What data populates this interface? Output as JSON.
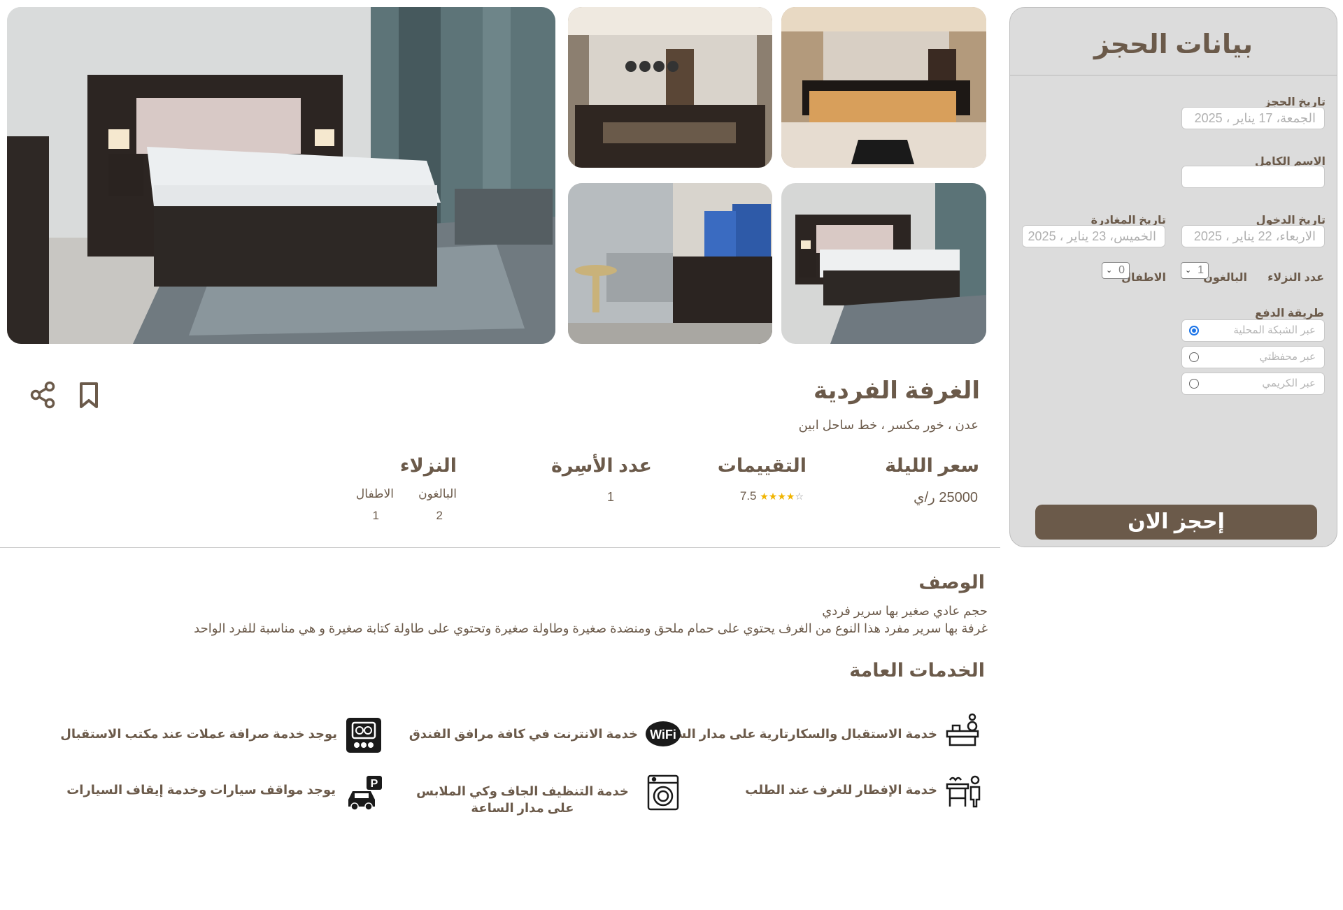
{
  "booking_panel": {
    "title": "بيانات الحجز",
    "booking_date_label": "تاريخ الحجز",
    "booking_date_value": "الجمعة، 17 يناير ، 2025",
    "full_name_label": "الاسم الكامل",
    "full_name_value": "",
    "checkin_label": "تاريخ الدخول",
    "checkin_value": "الاربعاء، 22 يناير ، 2025",
    "checkout_label": "تاريخ المغادرة",
    "checkout_value": "الخميس، 23 يناير ، 2025",
    "guests_label": "عدد النزلاء",
    "adults_label": "البالغون",
    "adults_value": "1",
    "children_label": "الاطفال",
    "children_value": "0",
    "payment_label": "طريقة الدفع",
    "payment_options": [
      {
        "label": "عبر الشبكة المحلية",
        "selected": true
      },
      {
        "label": "عبر محفظتي",
        "selected": false
      },
      {
        "label": "عبر الكريمي",
        "selected": false
      }
    ],
    "book_button": "إحجز الان"
  },
  "room": {
    "title": "الغرفة الفردية",
    "location": "عدن ، خور مكسر ، خط ساحل ابين",
    "price_label": "سعر الليلة",
    "price_value": "25000 ر/ي",
    "ratings_label": "التقييمات",
    "rating_value": "7.5",
    "rating_stars": 4,
    "beds_label": "عدد الأسِرة",
    "beds_value": "1",
    "guests_label": "النزلاء",
    "adults_label": "البالغون",
    "adults_value": "2",
    "children_label": "الاطفال",
    "children_value": "1"
  },
  "description": {
    "heading": "الوصف",
    "line1": "حجم عادي صغير بها سرير فردي",
    "line2": "غرفة بها سرير مفرد هذا النوع من الغرف يحتوي على حمام ملحق ومنضدة صغيرة وطاولة صغيرة وتحتوي على طاولة كتابة صغيرة و هي مناسبة للفرد الواحد"
  },
  "services": {
    "heading": "الخدمات العامة",
    "items": [
      {
        "label": "خدمة الاستقبال والسكارتارية على مدار الساعة",
        "icon": "reception-desk-icon"
      },
      {
        "label": "خدمة الانترنت في كافة مرافق الفندق",
        "icon": "wifi-icon"
      },
      {
        "label": "يوجد خدمة صرافة عملات عند مكتب الاستقبال",
        "icon": "currency-exchange-icon"
      },
      {
        "label": "خدمة الإفطار للغرف عند الطلب",
        "icon": "room-service-icon"
      },
      {
        "label": "خدمة التنظيف الجاف وكي الملابس على مدار الساعة",
        "icon": "washing-machine-icon"
      },
      {
        "label": "يوجد مواقف سيارات وخدمة إيقاف السيارات",
        "icon": "parking-icon"
      }
    ]
  },
  "gallery": {
    "photos": [
      "bedroom-main-photo",
      "reception-photo-1",
      "reception-photo-2",
      "lounge-photo",
      "bedroom-photo-2"
    ]
  },
  "actions": {
    "bookmark_icon": "bookmark-icon",
    "share_icon": "share-icon"
  },
  "colors": {
    "brand": "#6b5a4a",
    "panel_bg": "#dcdcdc",
    "radio_active": "#1a73e8"
  }
}
